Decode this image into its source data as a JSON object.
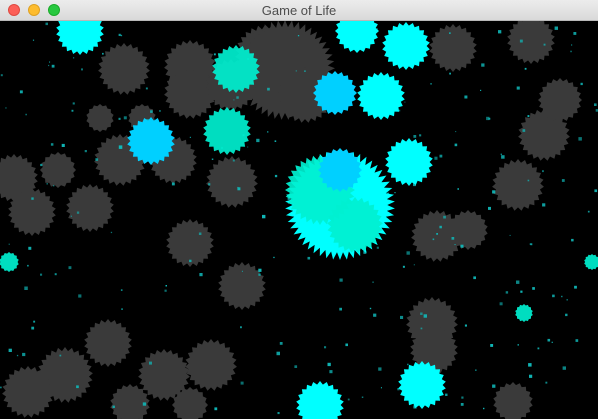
{
  "window": {
    "title": "Game of Life"
  },
  "titlebar": {
    "buttons": [
      {
        "name": "close",
        "color": "#fc5f57"
      },
      {
        "name": "minimize",
        "color": "#fdbc2e"
      },
      {
        "name": "zoom",
        "color": "#28c840"
      }
    ]
  },
  "colors": {
    "background": "#000000",
    "dead_cell": "#3a3a3a",
    "live_cell_cyan": "#00ffff",
    "live_cell_aqua": "#00f0d0",
    "live_cell_sky": "#00d0ff",
    "particle": "#10b8b8"
  }
}
